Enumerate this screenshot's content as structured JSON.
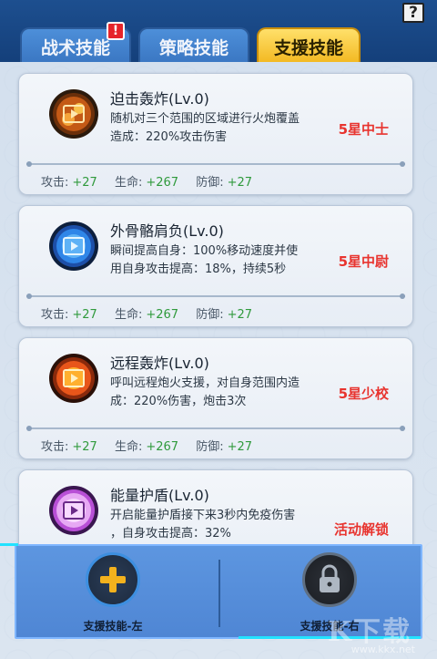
{
  "tabs": [
    {
      "label": "战术技能",
      "active": false,
      "badge": "!"
    },
    {
      "label": "策略技能",
      "active": false
    },
    {
      "label": "支援技能",
      "active": true
    }
  ],
  "help_label": "?",
  "skills": [
    {
      "name": "迫击轰炸(Lv.0)",
      "desc_line1": "随机对三个范围的区域进行火炮覆盖",
      "desc_line2": "造成：220%攻击伤害",
      "rank": "5星中士",
      "icon": "artillery-icon",
      "icon_color": "#e07a22",
      "stats": {
        "attack_label": "攻击:",
        "attack": "+27",
        "hp_label": "生命:",
        "hp": "+267",
        "def_label": "防御:",
        "def": "+27"
      }
    },
    {
      "name": "外骨骼肩负(Lv.0)",
      "desc_line1": "瞬间提高自身：100%移动速度并使",
      "desc_line2": "用自身攻击提高：18%，持续5秒",
      "rank": "5星中尉",
      "icon": "exoskeleton-icon",
      "icon_color": "#2a7ee8",
      "stats": {
        "attack_label": "攻击:",
        "attack": "+27",
        "hp_label": "生命:",
        "hp": "+267",
        "def_label": "防御:",
        "def": "+27"
      }
    },
    {
      "name": "远程轰炸(Lv.0)",
      "desc_line1": "呼叫远程炮火支援，对自身范围内造",
      "desc_line2": "成：220%伤害，炮击3次",
      "rank": "5星少校",
      "icon": "bombardment-icon",
      "icon_color": "#e8561a",
      "stats": {
        "attack_label": "攻击:",
        "attack": "+27",
        "hp_label": "生命:",
        "hp": "+267",
        "def_label": "防御:",
        "def": "+27"
      }
    },
    {
      "name": "能量护盾(Lv.0)",
      "desc_line1": "开启能量护盾接下来3秒内免疫伤害",
      "desc_line2": "，自身攻击提高：32%",
      "rank": "活动解锁",
      "icon": "energy-shield-icon",
      "icon_color": "#b84fd6"
    }
  ],
  "slots": [
    {
      "label": "支援技能-左",
      "icon": "plus-icon",
      "state": "empty"
    },
    {
      "label": "支援技能-右",
      "icon": "lock-icon",
      "state": "locked"
    }
  ],
  "watermark": {
    "text": "K下载",
    "url": "www.kkx.net"
  },
  "colors": {
    "rank": "#e8342f",
    "stat_value": "#2f9a3c",
    "active_tab": "#f2b71f",
    "inactive_tab": "#3a76c2"
  }
}
